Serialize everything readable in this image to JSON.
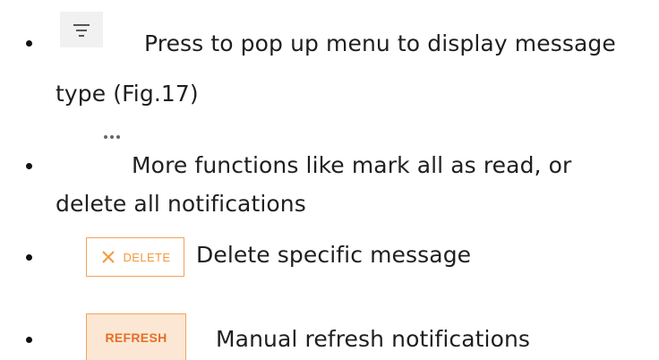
{
  "items": [
    {
      "icon": "filter-icon",
      "line1": "Press to pop up menu to display message",
      "line2": "type  (Fig.17)"
    },
    {
      "icon": "more-icon",
      "line1": "More functions like mark all as read, or",
      "line2": "delete all notifications"
    },
    {
      "icon": "delete-button",
      "button_label": "DELETE",
      "line1": "Delete specific message"
    },
    {
      "icon": "refresh-button",
      "button_label": "REFRESH",
      "line1": "Manual refresh notifications"
    }
  ],
  "colors": {
    "accent_orange": "#f39a3c",
    "refresh_fill": "#fbe7d4"
  }
}
